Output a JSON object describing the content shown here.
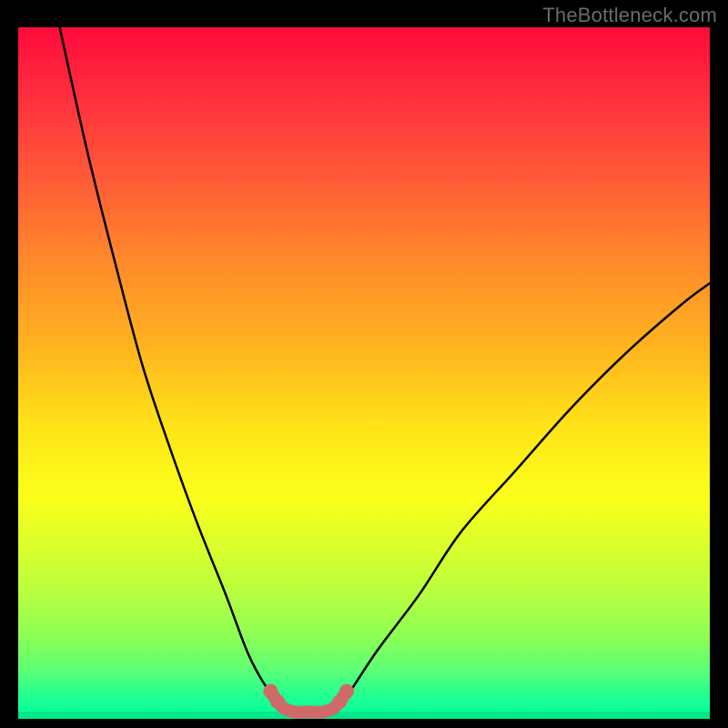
{
  "watermark": "TheBottleneck.com",
  "colors": {
    "curve": "#000000",
    "u_marker": "#cf6a6a",
    "green_band": "#00e888",
    "gradient_top": "#ff0a3a",
    "gradient_bottom": "#00ff9c"
  },
  "chart_data": {
    "type": "line",
    "title": "",
    "xlabel": "",
    "ylabel": "",
    "xlim": [
      0,
      100
    ],
    "ylim": [
      0,
      100
    ],
    "series": [
      {
        "name": "left-branch",
        "x": [
          6,
          10,
          14,
          18,
          22,
          26,
          30,
          33,
          35,
          37,
          38
        ],
        "y": [
          100,
          82,
          66,
          51,
          39,
          28,
          18,
          10,
          6,
          3,
          1.5
        ]
      },
      {
        "name": "right-branch",
        "x": [
          46,
          48,
          52,
          58,
          64,
          72,
          80,
          88,
          96,
          100
        ],
        "y": [
          1.5,
          4,
          10,
          18,
          27,
          36,
          45,
          53,
          60,
          63
        ]
      },
      {
        "name": "u-bottom-marker",
        "x": [
          36.5,
          37.5,
          38.5,
          40,
          42,
          44,
          45.5,
          46.5,
          47.5
        ],
        "y": [
          4,
          2.5,
          1.5,
          1,
          1,
          1,
          1.5,
          2.5,
          4
        ]
      }
    ],
    "annotations": [
      {
        "text": "TheBottleneck.com",
        "pos": "top-right",
        "role": "watermark"
      }
    ]
  }
}
